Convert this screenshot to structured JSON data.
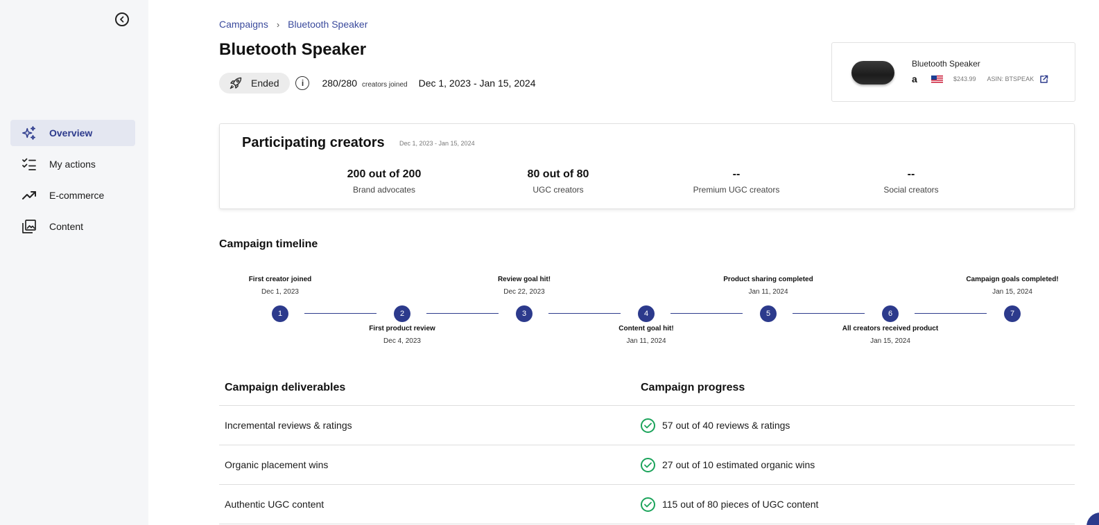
{
  "breadcrumb": {
    "root": "Campaigns",
    "separator": "›",
    "current": "Bluetooth Speaker"
  },
  "page": {
    "title": "Bluetooth Speaker"
  },
  "status": {
    "badge": "Ended",
    "joined_count": "280/280",
    "joined_suffix": "creators joined",
    "date_range": "Dec 1, 2023 - Jan 15, 2024"
  },
  "product": {
    "name": "Bluetooth Speaker",
    "marketplace_icon": "a",
    "price": "$243.99",
    "asin": "ASIN: BTSPEAK"
  },
  "sidebar": {
    "items": [
      {
        "label": "Overview",
        "icon": "sparkle-icon",
        "active": true
      },
      {
        "label": "My actions",
        "icon": "checklist-icon",
        "active": false
      },
      {
        "label": "E-commerce",
        "icon": "trend-up-icon",
        "active": false
      },
      {
        "label": "Content",
        "icon": "gallery-icon",
        "active": false
      }
    ]
  },
  "creators": {
    "title": "Participating creators",
    "date_range": "Dec 1, 2023 - Jan 15, 2024",
    "stats": [
      {
        "value": "200 out of 200",
        "label": "Brand advocates"
      },
      {
        "value": "80 out of 80",
        "label": "UGC creators"
      },
      {
        "value": "--",
        "label": "Premium UGC creators"
      },
      {
        "value": "--",
        "label": "Social creators"
      }
    ]
  },
  "timeline": {
    "title": "Campaign timeline",
    "events": [
      {
        "num": "1",
        "title": "First creator joined",
        "date": "Dec 1, 2023"
      },
      {
        "num": "2",
        "title": "First product review",
        "date": "Dec 4, 2023"
      },
      {
        "num": "3",
        "title": "Review goal hit!",
        "date": "Dec 22, 2023"
      },
      {
        "num": "4",
        "title": "Content goal hit!",
        "date": "Jan 11, 2024"
      },
      {
        "num": "5",
        "title": "Product sharing completed",
        "date": "Jan 11, 2024"
      },
      {
        "num": "6",
        "title": "All creators received product",
        "date": "Jan 15, 2024"
      },
      {
        "num": "7",
        "title": "Campaign goals completed!",
        "date": "Jan 15, 2024"
      }
    ]
  },
  "deliverables": {
    "header_deliverables": "Campaign deliverables",
    "header_progress": "Campaign progress",
    "rows": [
      {
        "name": "Incremental reviews & ratings",
        "progress": "57 out of 40 reviews & ratings"
      },
      {
        "name": "Organic placement wins",
        "progress": "27 out of 10 estimated organic wins"
      },
      {
        "name": "Authentic UGC content",
        "progress": "115 out of 80 pieces of UGC content"
      }
    ]
  },
  "colors": {
    "accent": "#2c3a8c",
    "success": "#1aa35a",
    "sidebar_bg": "#f5f6f8"
  }
}
